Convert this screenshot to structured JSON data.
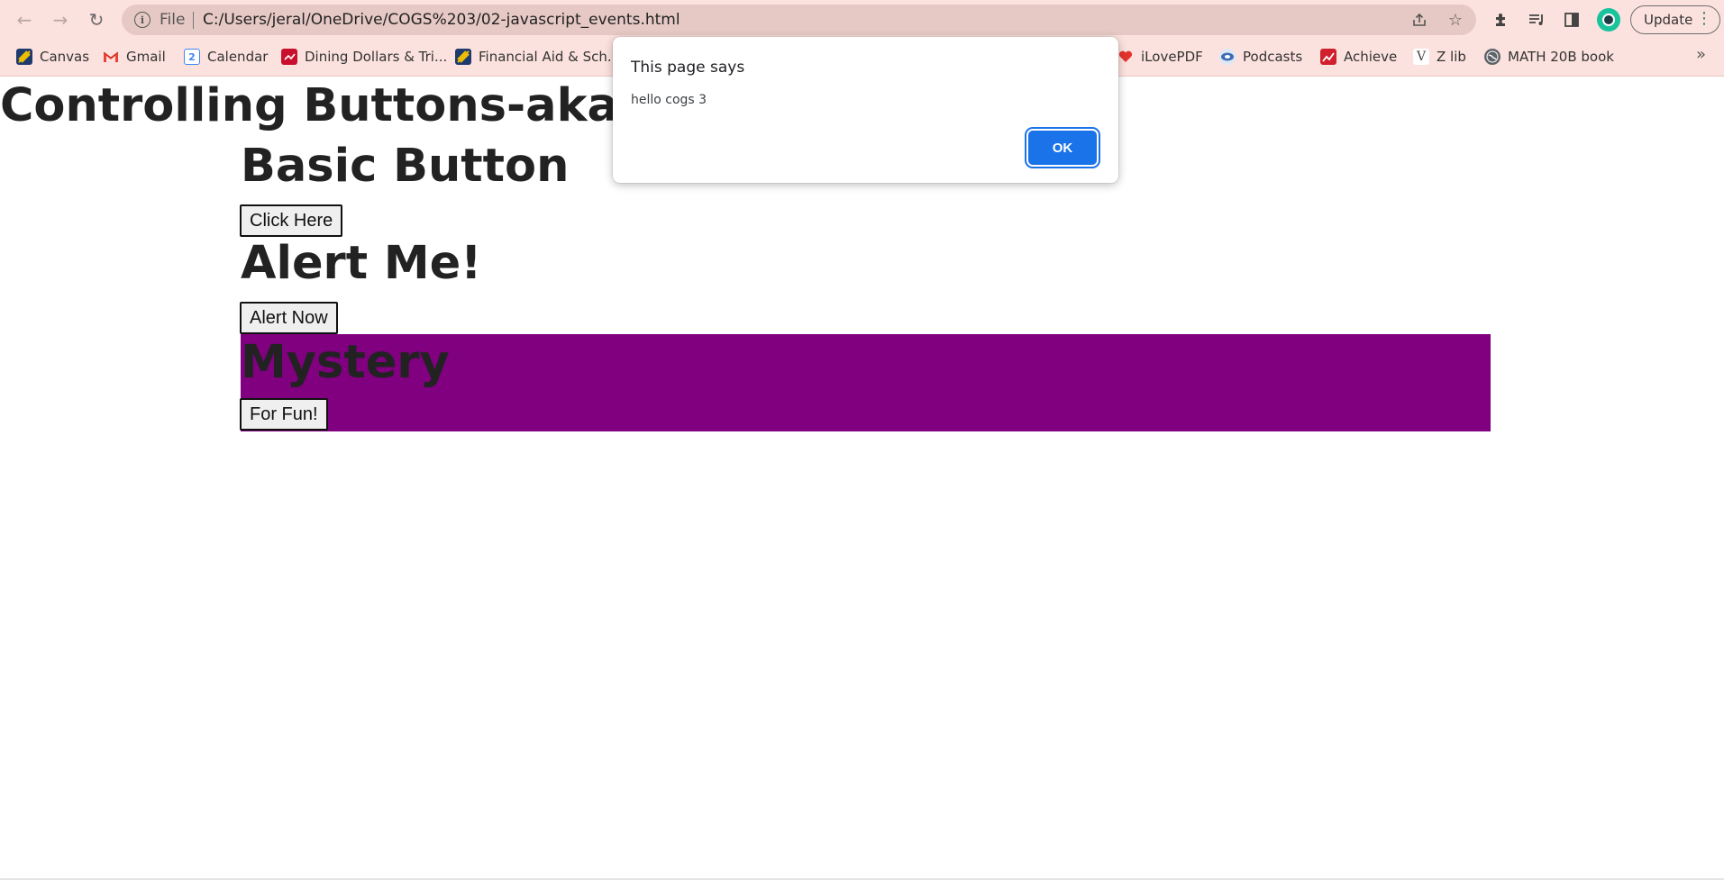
{
  "browser": {
    "address": {
      "scheme_label": "File",
      "url": "C:/Users/jeral/OneDrive/COGS%203/02-javascript_events.html"
    },
    "update_label": "Update",
    "bookmarks": [
      {
        "label": "Canvas",
        "icon": "canvas-icon",
        "color": "#1f3a6e"
      },
      {
        "label": "Gmail",
        "icon": "gmail-icon",
        "color": "#ea4335"
      },
      {
        "label": "Calendar",
        "icon": "calendar-icon",
        "color": "#4285f4",
        "glyph": "2"
      },
      {
        "label": "Dining Dollars & Tri...",
        "icon": "dining-icon",
        "color": "#c8102e"
      },
      {
        "label": "Financial Aid & Sch...",
        "icon": "financial-aid-icon",
        "color": "#1f3a6e"
      },
      {
        "label": "iLovePDF",
        "icon": "ilovepdf-icon",
        "color": "#e5322d"
      },
      {
        "label": "Podcasts",
        "icon": "podcasts-icon",
        "color": "#3d6db5"
      },
      {
        "label": "Achieve",
        "icon": "achieve-icon",
        "color": "#d0202e"
      },
      {
        "label": "Z lib",
        "icon": "zlib-icon",
        "color": "#555555",
        "glyph": "V"
      },
      {
        "label": "MATH 20B book",
        "icon": "globe-icon",
        "color": "#5f6368"
      }
    ]
  },
  "page": {
    "title": "Controlling Buttons-aka Events",
    "sections": [
      {
        "heading": "Basic Button",
        "button": "Click Here"
      },
      {
        "heading": "Alert Me!",
        "button": "Alert Now"
      },
      {
        "heading": "Mystery",
        "button": "For Fun!",
        "background": "#800080"
      }
    ]
  },
  "dialog": {
    "title": "This page says",
    "message": "hello cogs 3",
    "ok_label": "OK",
    "accent": "#1a73e8"
  }
}
